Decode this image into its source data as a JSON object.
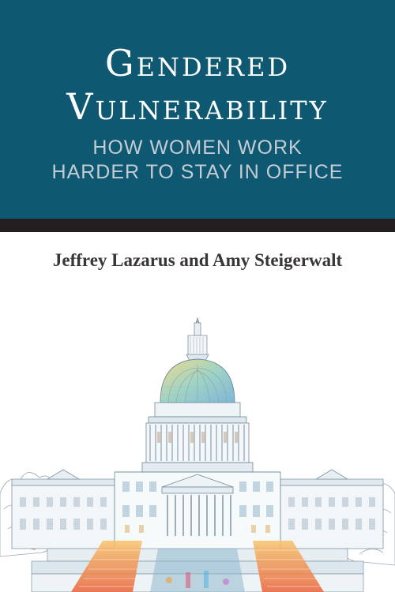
{
  "book": {
    "title_line1": "Gendered",
    "title_line2": "Vulnerability",
    "subtitle_line1": "HOW WOMEN WORK",
    "subtitle_line2": "HARDER TO STAY IN OFFICE",
    "authors": "Jeffrey Lazarus and Amy Steigerwalt"
  },
  "colors": {
    "title_band": "#0e5872",
    "rule": "#231f20",
    "title_text": "#ffffff",
    "subtitle_text": "#c4cdd5",
    "author_text": "#3a3636"
  },
  "illustration": {
    "subject": "capitol-building-sketch"
  }
}
